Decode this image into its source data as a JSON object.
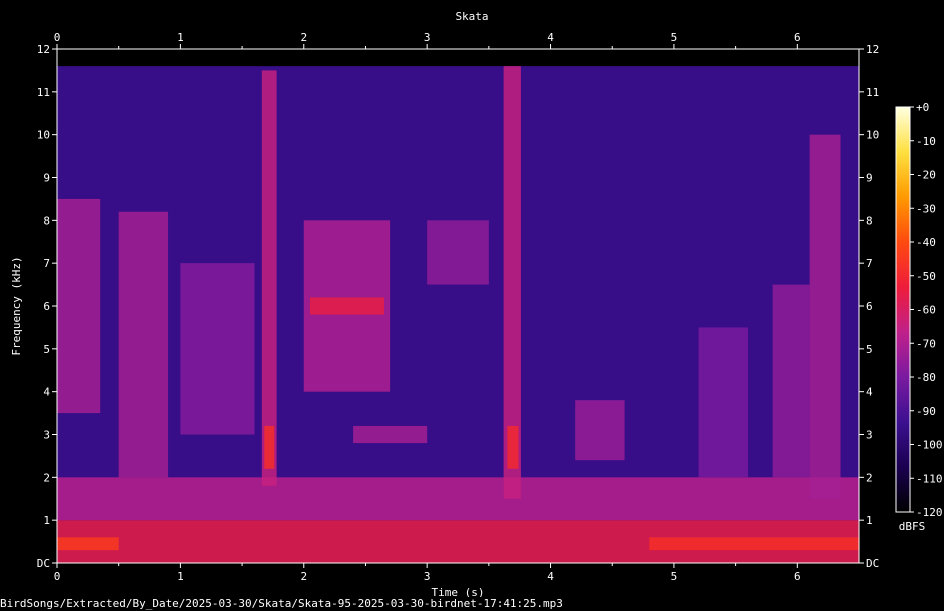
{
  "footer": {
    "file_path": "BirdSongs/Extracted/By_Date/2025-03-30/Skata/Skata-95-2025-03-30-birdnet-17:41:25.mp3"
  },
  "chart_data": {
    "type": "heatmap",
    "title": "Skata",
    "xlabel": "Time (s)",
    "ylabel": "Frequency (kHz)",
    "xlim": [
      0,
      6.5
    ],
    "ylim": [
      0,
      12
    ],
    "x_ticks": [
      "0",
      "1",
      "2",
      "3",
      "4",
      "5",
      "6"
    ],
    "y_ticks": [
      "DC",
      "1",
      "2",
      "3",
      "4",
      "5",
      "6",
      "7",
      "8",
      "9",
      "10",
      "11",
      "12"
    ],
    "colorbar": {
      "label": "dBFS",
      "range": [
        -120,
        0
      ],
      "ticks": [
        "+0",
        "-10",
        "-20",
        "-30",
        "-40",
        "-50",
        "-60",
        "-70",
        "-80",
        "-90",
        "-100",
        "-110",
        "-120"
      ],
      "colors": [
        "#000000",
        "#1a0050",
        "#3c1090",
        "#7a1aa0",
        "#c0208a",
        "#ee1c3a",
        "#ff4a10",
        "#ff9a00",
        "#ffe040",
        "#ffffe0"
      ]
    },
    "background_level_db": -95,
    "events": [
      {
        "t0": 0.0,
        "t1": 6.5,
        "f0": 0.0,
        "f1": 1.0,
        "db": -55
      },
      {
        "t0": 0.0,
        "t1": 6.5,
        "f0": 1.0,
        "f1": 2.0,
        "db": -68
      },
      {
        "t0": 0.0,
        "t1": 0.35,
        "f0": 3.5,
        "f1": 8.5,
        "db": -72
      },
      {
        "t0": 0.5,
        "t1": 0.9,
        "f0": 2.0,
        "f1": 8.2,
        "db": -72
      },
      {
        "t0": 1.0,
        "t1": 1.6,
        "f0": 3.0,
        "f1": 7.0,
        "db": -78
      },
      {
        "t0": 1.66,
        "t1": 1.78,
        "f0": 1.8,
        "f1": 11.5,
        "db": -65
      },
      {
        "t0": 1.68,
        "t1": 1.76,
        "f0": 2.2,
        "f1": 3.2,
        "db": -48
      },
      {
        "t0": 2.0,
        "t1": 2.7,
        "f0": 4.0,
        "f1": 8.0,
        "db": -70
      },
      {
        "t0": 2.05,
        "t1": 2.65,
        "f0": 5.8,
        "f1": 6.2,
        "db": -55
      },
      {
        "t0": 2.4,
        "t1": 3.0,
        "f0": 2.8,
        "f1": 3.2,
        "db": -72
      },
      {
        "t0": 3.0,
        "t1": 3.5,
        "f0": 6.5,
        "f1": 8.0,
        "db": -76
      },
      {
        "t0": 3.62,
        "t1": 3.76,
        "f0": 1.5,
        "f1": 11.6,
        "db": -65
      },
      {
        "t0": 3.65,
        "t1": 3.74,
        "f0": 2.2,
        "f1": 3.2,
        "db": -50
      },
      {
        "t0": 4.2,
        "t1": 4.6,
        "f0": 2.4,
        "f1": 3.8,
        "db": -74
      },
      {
        "t0": 5.2,
        "t1": 5.6,
        "f0": 2.0,
        "f1": 5.5,
        "db": -80
      },
      {
        "t0": 5.8,
        "t1": 6.1,
        "f0": 2.0,
        "f1": 6.5,
        "db": -76
      },
      {
        "t0": 6.1,
        "t1": 6.35,
        "f0": 1.5,
        "f1": 10.0,
        "db": -72
      },
      {
        "t0": 0.0,
        "t1": 0.5,
        "f0": 0.3,
        "f1": 0.6,
        "db": -45
      },
      {
        "t0": 4.8,
        "t1": 6.5,
        "f0": 0.3,
        "f1": 0.6,
        "db": -48
      }
    ]
  }
}
